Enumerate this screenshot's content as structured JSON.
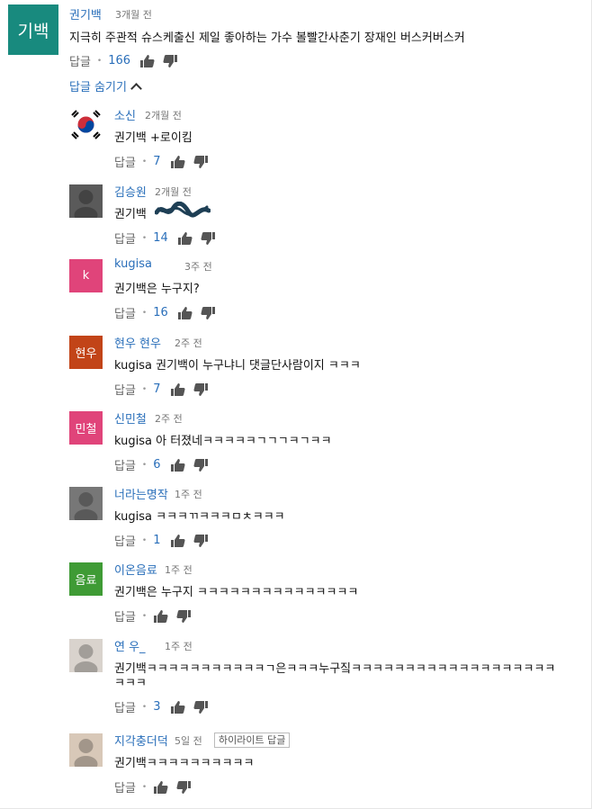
{
  "main_comment": {
    "avatar_text": "기백",
    "avatar_color": "#188a7e",
    "author": "권기백",
    "time": "3개월 전",
    "text": "지극히 주관적 슈스케출신 제일 좋아하는 가수 볼빨간사춘기 장재인 버스커버스커",
    "reply_label": "답글",
    "likes": "166",
    "hide_replies_label": "답글 숨기기"
  },
  "replies": [
    {
      "author": "소신",
      "time": "2개월 전",
      "text": "권기백 +로이킴",
      "reply_label": "답글",
      "likes": "7",
      "avatar_text": "",
      "avatar_color": "#ffffff",
      "avatar_icon": "taegeuk-flag-icon"
    },
    {
      "author": "김승원",
      "time": "2개월 전",
      "text": "권기백 ",
      "reply_label": "답글",
      "likes": "14",
      "avatar_text": "",
      "avatar_color": "#5a5a5a",
      "avatar_icon": "photo-avatar"
    },
    {
      "author": "kugisa",
      "time": "3주 전",
      "text": "권기백은 누구지?",
      "reply_label": "답글",
      "likes": "16",
      "avatar_text": "k",
      "avatar_color": "#e0447a"
    },
    {
      "author": "현우 현우",
      "time": "2주 전",
      "text": "kugisa 권기백이 누구냐니 댓글단사람이지 ㅋㅋㅋ",
      "reply_label": "답글",
      "likes": "7",
      "avatar_text": "현우",
      "avatar_color": "#c24418"
    },
    {
      "author": "신민철",
      "time": "2주 전",
      "text": "kugisa 아 터졌네ㅋㅋㅋㅋㅋㄱㄱㄱㅋㄱㅋㅋ",
      "reply_label": "답글",
      "likes": "6",
      "avatar_text": "민철",
      "avatar_color": "#e0447a"
    },
    {
      "author": "너라는명작",
      "time": "1주 전",
      "text": "kugisa ㅋㅋㅋㄲㅋㅋㅋㅁㅊㅋㅋㅋ",
      "reply_label": "답글",
      "likes": "1",
      "avatar_text": "",
      "avatar_color": "#777777",
      "avatar_icon": "photo-avatar"
    },
    {
      "author": "이온음료",
      "time": "1주 전",
      "text": "권기백은 누구지 ㅋㅋㅋㅋㅋㅋㅋㅋㅋㅋㅋㅋㅋㅋㅋ",
      "reply_label": "답글",
      "likes": "",
      "avatar_text": "음료",
      "avatar_color": "#3f9b35"
    },
    {
      "author": "연 우_",
      "time": "1주 전",
      "text": "권기백ㅋㅋㅋㅋㅋㅋㅋㅋㅋㅋㅋㄱ은ㅋㅋㅋ누구짘ㅋㅋㅋㅋㅋㅋㅋㅋㅋㅋㅋㅋㅋㅋㅋㅋㅋㅋㅋ",
      "text2": "ㅋㅋㅋ",
      "reply_label": "답글",
      "likes": "3",
      "avatar_text": "",
      "avatar_color": "#d9d3cd",
      "avatar_icon": "photo-avatar"
    },
    {
      "author": "지각충더덕",
      "time": "5일 전",
      "badge": "하이라이트 답글",
      "text": "권기백ㅋㅋㅋㅋㅋㅋㅋㅋㅋㅋ",
      "reply_label": "답글",
      "likes": "",
      "avatar_text": "",
      "avatar_color": "#d8c8b8",
      "avatar_icon": "photo-avatar"
    }
  ],
  "colors": {
    "link": "#2a6fba",
    "meta": "#777777",
    "text": "#111111"
  }
}
